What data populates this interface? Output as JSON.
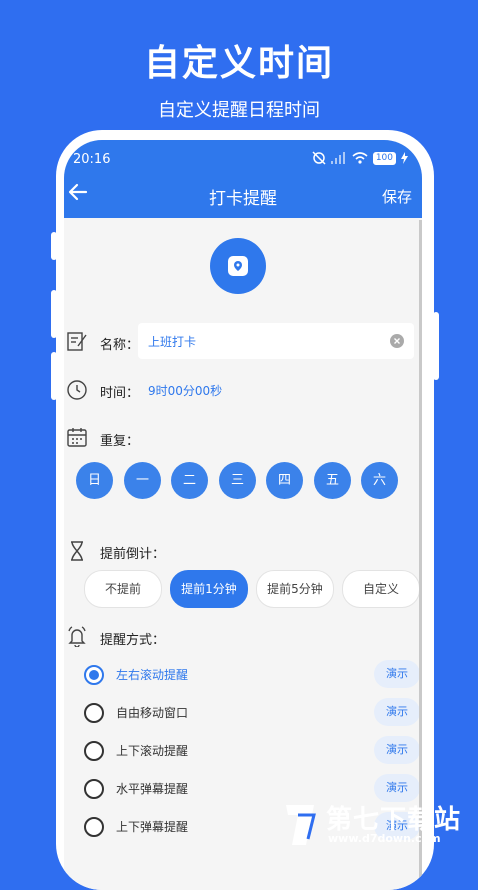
{
  "promo": {
    "title": "自定义时间",
    "subtitle": "自定义提醒日程时间"
  },
  "status": {
    "time": "20:16",
    "battery": "100"
  },
  "header": {
    "title": "打卡提醒",
    "save_label": "保存"
  },
  "form": {
    "name_label": "名称：",
    "name_value": "上班打卡",
    "time_label": "时间：",
    "time_value": "9时00分00秒",
    "repeat_label": "重复：",
    "days": [
      "日",
      "一",
      "二",
      "三",
      "四",
      "五",
      "六"
    ],
    "countdown_label": "提前倒计：",
    "countdown_options": [
      "不提前",
      "提前1分钟",
      "提前5分钟",
      "自定义"
    ],
    "countdown_selected": "提前1分钟",
    "mode_label": "提醒方式：",
    "modes": [
      {
        "label": "左右滚动提醒",
        "demo": "演示"
      },
      {
        "label": "自由移动窗口",
        "demo": "演示"
      },
      {
        "label": "上下滚动提醒",
        "demo": "演示"
      },
      {
        "label": "水平弹幕提醒",
        "demo": "演示"
      },
      {
        "label": "上下弹幕提醒",
        "demo": "演示"
      }
    ],
    "mode_selected": "左右滚动提醒"
  },
  "watermark": {
    "brand": "第七下载站",
    "url": "www.d7down.com"
  },
  "colors": {
    "accent": "#2f78ec",
    "background": "#2f6ef0"
  },
  "icons": {
    "back": "back-arrow-icon",
    "app": "shield-location-icon",
    "name": "edit-note-icon",
    "time": "clock-icon",
    "repeat": "calendar-icon",
    "countdown": "hourglass-icon",
    "mode": "bell-icon",
    "clear": "clear-icon"
  }
}
